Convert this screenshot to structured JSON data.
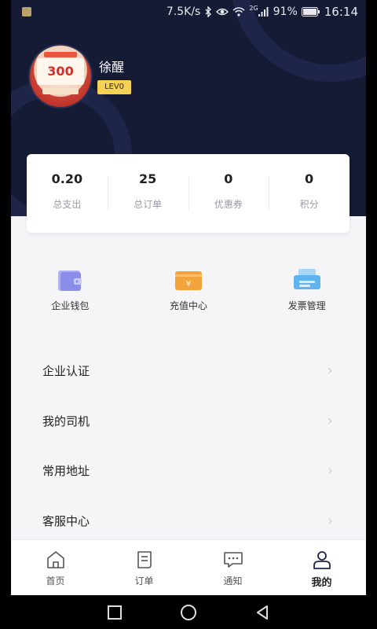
{
  "status_bar": {
    "speed": "7.5K/s",
    "network": "2G",
    "battery": "91%",
    "time": "16:14",
    "icons": [
      "notification-icon",
      "bluetooth-icon",
      "eye-icon",
      "wifi-icon",
      "signal-icon",
      "battery-icon"
    ]
  },
  "profile": {
    "name": "徐醒",
    "level": "LEV0",
    "avatar_text": "300"
  },
  "stats": [
    {
      "value": "0.20",
      "label": "总支出"
    },
    {
      "value": "25",
      "label": "总订单"
    },
    {
      "value": "0",
      "label": "优惠券"
    },
    {
      "value": "0",
      "label": "积分"
    }
  ],
  "quick_actions": [
    {
      "label": "企业钱包",
      "icon": "wallet-icon",
      "color": "#8a8ee8"
    },
    {
      "label": "充值中心",
      "icon": "recharge-icon",
      "color": "#f3a33c"
    },
    {
      "label": "发票管理",
      "icon": "invoice-icon",
      "color": "#5fb3ee"
    }
  ],
  "menu": [
    {
      "label": "企业认证"
    },
    {
      "label": "我的司机"
    },
    {
      "label": "常用地址"
    },
    {
      "label": "客服中心"
    }
  ],
  "tabs": [
    {
      "label": "首页",
      "icon": "home-icon",
      "active": false
    },
    {
      "label": "订单",
      "icon": "order-icon",
      "active": false
    },
    {
      "label": "通知",
      "icon": "message-icon",
      "active": false
    },
    {
      "label": "我的",
      "icon": "user-icon",
      "active": true
    }
  ],
  "colors": {
    "header_bg": "#151a35",
    "level_badge": "#f6d154",
    "page_bg": "#f5f5f7"
  }
}
